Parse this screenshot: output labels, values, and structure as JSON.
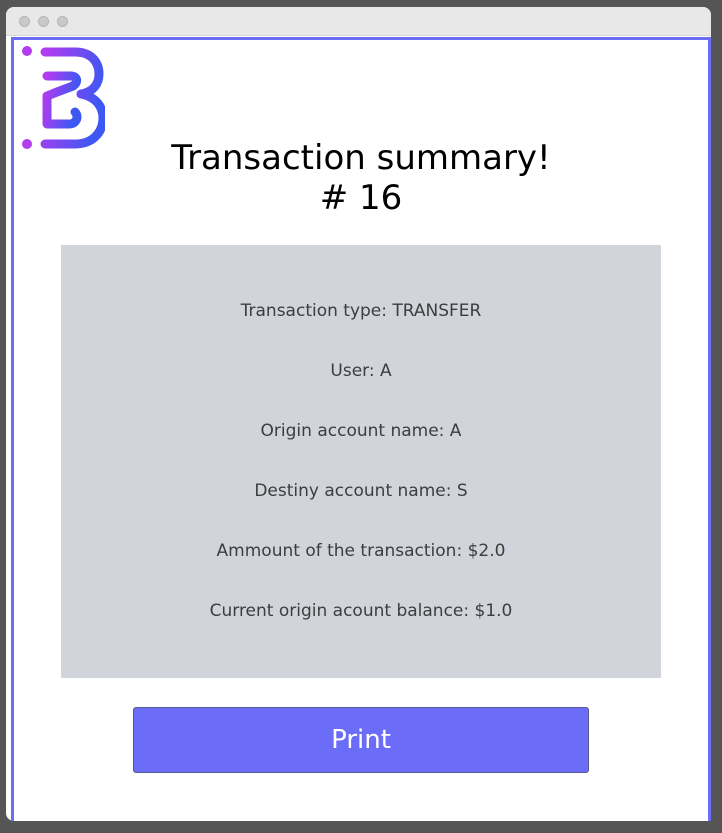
{
  "header": {
    "title": "Transaction summary!",
    "number": "# 16"
  },
  "details": {
    "transaction_type": "Transaction type: TRANSFER",
    "user": "User: A",
    "origin_account": "Origin account name: A",
    "destiny_account": "Destiny account name: S",
    "amount": "Ammount of the transaction: $2.0",
    "balance": "Current origin acount balance: $1.0"
  },
  "actions": {
    "print_label": "Print"
  },
  "colors": {
    "accent": "#6b6cf8",
    "panel": "#d2d4db",
    "logo_gradient_start": "#b33bf0",
    "logo_gradient_end": "#3f57f2"
  },
  "icons": {
    "logo": "bank-logo-icon"
  }
}
